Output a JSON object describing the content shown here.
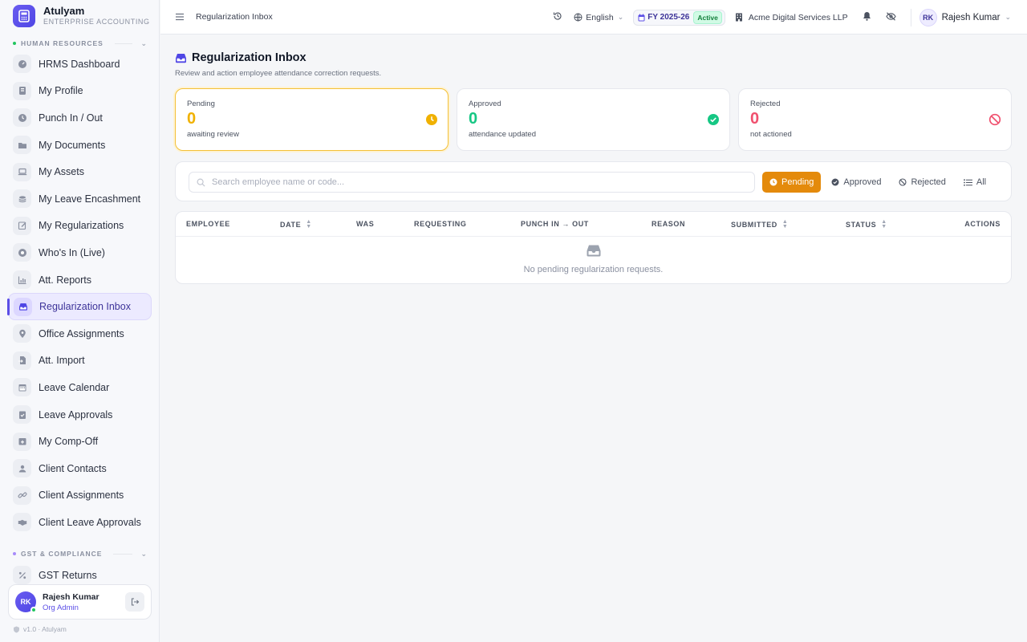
{
  "brand": {
    "name": "Atulyam",
    "subtitle": "ENTERPRISE ACCOUNTING"
  },
  "sidebar": {
    "section_hr": "HUMAN RESOURCES",
    "items": [
      {
        "label": "HRMS Dashboard",
        "icon": "gauge-icon"
      },
      {
        "label": "My Profile",
        "icon": "id-card-icon"
      },
      {
        "label": "Punch In / Out",
        "icon": "clock-icon"
      },
      {
        "label": "My Documents",
        "icon": "folder-icon"
      },
      {
        "label": "My Assets",
        "icon": "laptop-icon"
      },
      {
        "label": "My Leave Encashment",
        "icon": "coins-icon"
      },
      {
        "label": "My Regularizations",
        "icon": "edit-icon"
      },
      {
        "label": "Who's In (Live)",
        "icon": "live-dot-icon"
      },
      {
        "label": "Att. Reports",
        "icon": "chart-icon"
      },
      {
        "label": "Regularization Inbox",
        "icon": "inbox-icon",
        "active": true
      },
      {
        "label": "Office Assignments",
        "icon": "map-pin-icon"
      },
      {
        "label": "Att. Import",
        "icon": "file-import-icon"
      },
      {
        "label": "Leave Calendar",
        "icon": "calendar-icon"
      },
      {
        "label": "Leave Approvals",
        "icon": "clipboard-check-icon"
      },
      {
        "label": "My Comp-Off",
        "icon": "calendar-plus-icon"
      },
      {
        "label": "Client Contacts",
        "icon": "contact-icon"
      },
      {
        "label": "Client Assignments",
        "icon": "link-icon"
      },
      {
        "label": "Client Leave Approvals",
        "icon": "handshake-icon"
      }
    ],
    "section_gst": "GST & COMPLIANCE",
    "gst_items": [
      {
        "label": "GST Returns",
        "icon": "percent-icon"
      }
    ],
    "user": {
      "initials": "RK",
      "name": "Rajesh Kumar",
      "role": "Org Admin"
    },
    "version": "v1.0 · Atulyam"
  },
  "topbar": {
    "breadcrumb": "Regularization Inbox",
    "language": "English",
    "fy": "FY 2025-26",
    "fy_status": "Active",
    "company": "Acme Digital Services LLP",
    "user_initials": "RK",
    "user_name": "Rajesh Kumar"
  },
  "page": {
    "title": "Regularization Inbox",
    "subtitle": "Review and action employee attendance correction requests."
  },
  "stats": [
    {
      "label": "Pending",
      "value": "0",
      "desc": "awaiting review",
      "color": "#f0b100"
    },
    {
      "label": "Approved",
      "value": "0",
      "desc": "attendance updated",
      "color": "#16c784"
    },
    {
      "label": "Rejected",
      "value": "0",
      "desc": "not actioned",
      "color": "#f0506e"
    }
  ],
  "filters": {
    "search_placeholder": "Search employee name or code...",
    "tabs": [
      "Pending",
      "Approved",
      "Rejected",
      "All"
    ],
    "active": "Pending"
  },
  "table": {
    "columns": [
      "EMPLOYEE",
      "DATE",
      "WAS",
      "REQUESTING",
      "PUNCH IN → OUT",
      "REASON",
      "SUBMITTED",
      "STATUS",
      "ACTIONS"
    ],
    "empty_message": "No pending regularization requests."
  },
  "colors": {
    "accent": "#5b4ee6",
    "pending": "#e48a0b"
  }
}
